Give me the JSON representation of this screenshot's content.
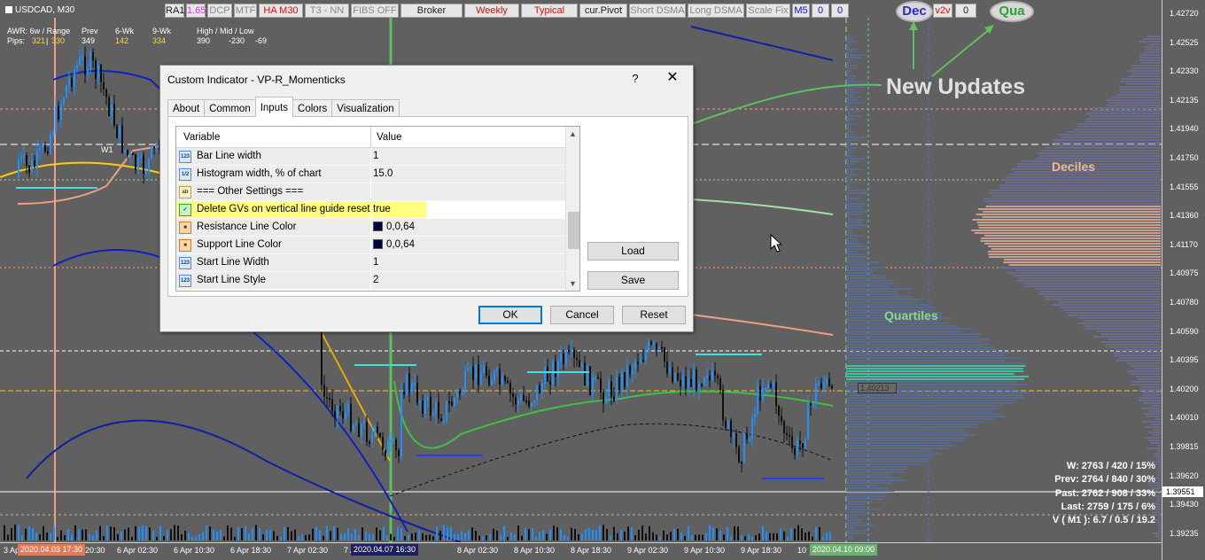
{
  "chart": {
    "symbol": "USDCAD, M30",
    "stats": {
      "row1": {
        "label": "AWR: 6w / Range",
        "prev": "Prev",
        "six_wk": "6-Wk",
        "nine_wk": "9-Wk",
        "hml": "High / Mid / Low"
      },
      "row2": {
        "label": "Pips:",
        "v1": "321",
        "v2": "330",
        "v3": "349",
        "v4": "142",
        "v5": "334",
        "hi": "390",
        "mid": "-230",
        "lo": "-69"
      }
    },
    "toolbar": [
      {
        "label": "RA1",
        "style": "dark"
      },
      {
        "label": "1.65",
        "style": "pink"
      },
      {
        "label": "DCP",
        "style": "grey"
      },
      {
        "label": "MTF",
        "style": "grey"
      },
      {
        "label": "HA M30",
        "style": "red"
      },
      {
        "label": "T3 - NN",
        "style": "grey"
      },
      {
        "label": "FIBS OFF",
        "style": "grey"
      },
      {
        "label": "Broker",
        "style": "dark"
      },
      {
        "label": "Weekly",
        "style": "red"
      },
      {
        "label": "Typical",
        "style": "red"
      },
      {
        "label": "cur.Pivot",
        "style": "dark"
      },
      {
        "label": "Short DSMA",
        "style": "grey"
      },
      {
        "label": "Long DSMA",
        "style": "grey"
      },
      {
        "label": "Scale Fix",
        "style": "grey"
      },
      {
        "label": "M5",
        "style": "blue"
      },
      {
        "label": "0",
        "style": "blue"
      },
      {
        "label": "0",
        "style": "blue"
      }
    ],
    "dec_button": "Dec",
    "v2v_button": "v2v",
    "zero_button": "0",
    "qua_button": "Qua",
    "annotations": {
      "new_updates": "New Updates",
      "deciles": "Deciles",
      "quartiles": "Quartiles",
      "w1": "W1"
    },
    "price_box": "1.40213",
    "price_labels": [
      "1.42720",
      "1.42525",
      "1.42330",
      "1.42135",
      "1.41940",
      "1.41750",
      "1.41555",
      "1.41360",
      "1.41170",
      "1.40975",
      "1.40780",
      "1.40590",
      "1.40395",
      "1.40200",
      "1.40010",
      "1.39815",
      "1.39620",
      "1.39430",
      "1.39235"
    ],
    "current_price": "1.39551",
    "time_labels": [
      "3 Apr 2020",
      "20:30",
      "6 Apr 02:30",
      "6 Apr 10:30",
      "6 Apr 18:30",
      "7 Apr 02:30",
      "7 Apr",
      "8 Apr 02:30",
      "8 Apr 10:30",
      "8 Apr 18:30",
      "9 Apr 02:30",
      "9 Apr 10:30",
      "9 Apr 18:30",
      "10"
    ],
    "time_highlights": {
      "start": "2020.04.03 17:30",
      "mid": "2020.04.07 16:30",
      "end": "2020.04.10 09:00"
    },
    "summary": {
      "w": "W: 2763 / 420 / 15%",
      "prev": "Prev: 2764 / 840 / 30%",
      "past": "Past: 2762 / 908 / 33%",
      "last": "Last: 2759 / 175 / 6%",
      "v": "V ( M1 ): 6.7 / 0.5 / 19.2"
    },
    "colors": {
      "background": "#606060",
      "up": "#1e90ff",
      "down": "#101010",
      "accent_green": "#60c060",
      "highlight": "#ffff80"
    }
  },
  "dialog": {
    "title": "Custom Indicator - VP-R_Momenticks",
    "help": "?",
    "close": "✕",
    "tabs": [
      "About",
      "Common",
      "Inputs",
      "Colors",
      "Visualization"
    ],
    "active_tab": "Inputs",
    "grid_headers": {
      "variable": "Variable",
      "value": "Value"
    },
    "rows": [
      {
        "icon": "123",
        "type": "int",
        "variable": "Bar Line width",
        "value": "1"
      },
      {
        "icon": "1/2",
        "type": "double",
        "variable": "Histogram width, % of chart",
        "value": "15.0"
      },
      {
        "icon": "ab",
        "type": "string",
        "variable": "=== Other Settings ===",
        "value": ""
      },
      {
        "icon": "✓",
        "type": "bool",
        "variable": "Delete GVs on vertical line guide reset",
        "value": "true"
      },
      {
        "icon": "■",
        "type": "color",
        "variable": "Resistance Line Color",
        "value": "0,0,64"
      },
      {
        "icon": "■",
        "type": "color",
        "variable": "Support Line Color",
        "value": "0,0,64"
      },
      {
        "icon": "123",
        "type": "int",
        "variable": "Start Line Width",
        "value": "1"
      },
      {
        "icon": "123",
        "type": "int",
        "variable": "Start Line Style",
        "value": "2"
      }
    ],
    "buttons": {
      "load": "Load",
      "save": "Save",
      "ok": "OK",
      "cancel": "Cancel",
      "reset": "Reset"
    }
  }
}
